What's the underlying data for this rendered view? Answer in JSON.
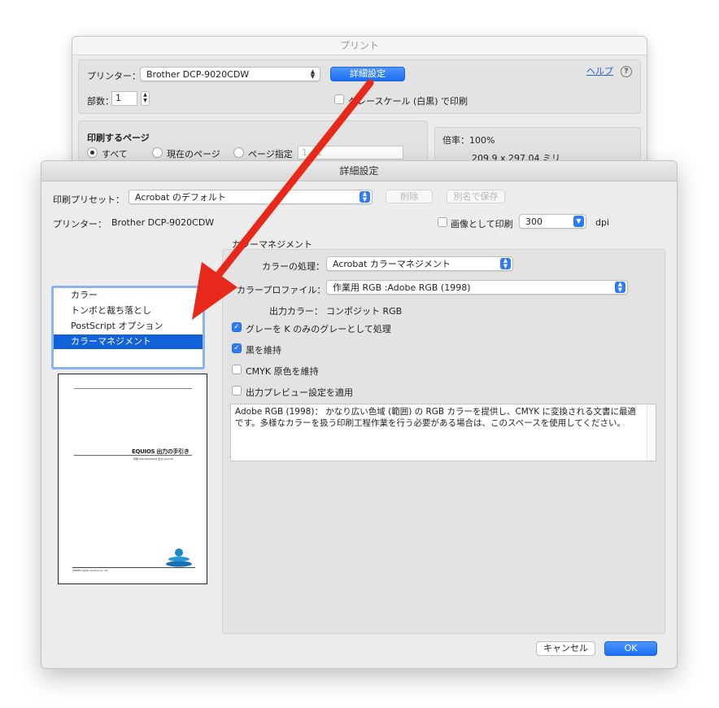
{
  "back_window": {
    "title": "プリント",
    "printer_label": "プリンター：",
    "printer_value": "Brother DCP-9020CDW",
    "advanced_button": "詳細設定",
    "help_link": "ヘルプ",
    "help_icon": "?",
    "copies_label": "部数：",
    "copies_value": "1",
    "grayscale_label": "グレースケール (白黒) で印刷",
    "pages_heading": "印刷するページ",
    "pages_all": "すべて",
    "pages_current": "現在のページ",
    "pages_range": "ページ指定",
    "pages_range_placeholder": "1 - 1",
    "scale_label": "倍率：100%",
    "paper_size": "209.9 x 297.04 ミリ"
  },
  "dialog": {
    "title": "詳細設定",
    "preset_label": "印刷プリセット：",
    "preset_value": "Acrobat のデフォルト",
    "delete_button": "削除",
    "save_as_button": "別名で保存",
    "printer_label": "プリンター：",
    "printer_value": "Brother DCP-9020CDW",
    "print_as_image_label": "画像として印刷",
    "dpi_value": "300",
    "dpi_unit": "dpi",
    "categories": [
      {
        "label": "カラー",
        "selected": false
      },
      {
        "label": "トンボと裁ち落とし",
        "selected": false
      },
      {
        "label": "PostScript オプション",
        "selected": false
      },
      {
        "label": "カラーマネジメント",
        "selected": true
      }
    ],
    "preview": {
      "doc_title": "EQUIOS 出力の手引き",
      "doc_subtitle": "印刷 DCP-9020CDW 出力 Ver2.00",
      "doc_footer": "SCREEN Graphic Solutions Co., Ltd."
    },
    "cm": {
      "group_title": "カラーマネジメント",
      "handling_label": "カラーの処理：",
      "handling_value": "Acrobat カラーマネジメント",
      "profile_label": "カラープロファイル：",
      "profile_value": "作業用 RGB :Adobe RGB (1998)",
      "output_color_label": "出力カラー：",
      "output_color_value": "コンポジット RGB",
      "options": [
        {
          "label": "グレーを K のみのグレーとして処理",
          "checked": true
        },
        {
          "label": "黒を維持",
          "checked": true
        },
        {
          "label": "CMYK 原色を維持",
          "checked": false
        },
        {
          "label": "出力プレビュー設定を適用",
          "checked": false
        }
      ],
      "description": "Adobe RGB (1998)： かなり広い色域 (範囲) の RGB カラーを提供し、CMYK に変換される文書に最適です。多様なカラーを扱う印刷工程作業を行う必要がある場合は、このスペースを使用してください。"
    },
    "cancel_button": "キャンセル",
    "ok_button": "OK"
  },
  "colors": {
    "accent": "#1b6ef3",
    "selection": "#1162d8",
    "annotation_arrow": "#e8281b"
  },
  "icons": [
    "popup-arrows-icon",
    "checkmark-icon",
    "help-icon",
    "annotation-arrow"
  ]
}
